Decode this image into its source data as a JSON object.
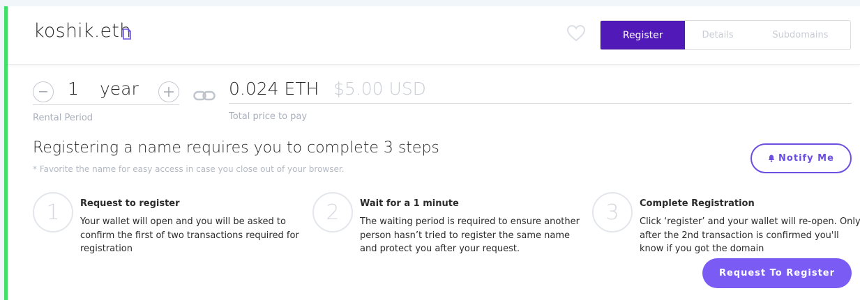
{
  "header": {
    "domain_name": "koshik.eth",
    "tabs": [
      {
        "label": "Register",
        "active": true
      },
      {
        "label": "Details",
        "active": false
      },
      {
        "label": "Subdomains",
        "active": false
      }
    ]
  },
  "pricing": {
    "years": "1",
    "year_unit": "year",
    "rental_period_label": "Rental Period",
    "eth_price": "0.024 ETH",
    "usd_price": "$5.00 USD",
    "total_label": "Total price to pay"
  },
  "steps_section": {
    "title": "Registering a name requires you to complete 3 steps",
    "note": "* Favorite the name for easy access in case you close out of your browser.",
    "notify_label": "Notify Me",
    "steps": [
      {
        "number": "1",
        "title": "Request to register",
        "text": "Your wallet will open and you will be asked to confirm the first of two transactions required for registration"
      },
      {
        "number": "2",
        "title": "Wait for a 1 minute",
        "text": "The waiting period is required to ensure another person hasn’t tried to register the same name and protect you after your request."
      },
      {
        "number": "3",
        "title": "Complete Registration",
        "text": "Click ‘register’ and your wallet will re-open. Only after the 2nd transaction is confirmed you'll know if you got the domain"
      }
    ],
    "request_button_label": "Request To Register"
  },
  "icons": {
    "copy": "copy-icon",
    "favorite": "heart-icon",
    "decrement": "minus-icon",
    "increment": "plus-icon",
    "link": "link-icon",
    "notify": "bell-icon"
  },
  "colors": {
    "accent_green": "#42e068",
    "tab_active": "#5119b7",
    "button_purple": "#7a5cf5",
    "notify_purple": "#6c4ee0"
  }
}
